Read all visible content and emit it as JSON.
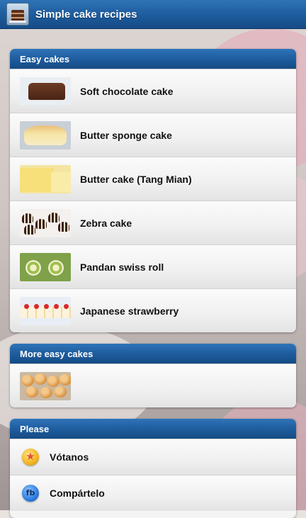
{
  "app": {
    "title": "Simple cake recipes",
    "icon": "cake-app-icon"
  },
  "sections": [
    {
      "header": "Easy cakes",
      "items": [
        {
          "label": "Soft chocolate cake",
          "thumb": "chocolate-cake-thumb"
        },
        {
          "label": "Butter sponge cake",
          "thumb": "sponge-cake-thumb"
        },
        {
          "label": "Butter cake (Tang Mian)",
          "thumb": "butter-cake-thumb"
        },
        {
          "label": "Zebra cake",
          "thumb": "zebra-cake-thumb"
        },
        {
          "label": "Pandan swiss roll",
          "thumb": "pandan-roll-thumb"
        },
        {
          "label": "Japanese strawberry",
          "thumb": "strawberry-cake-thumb"
        }
      ]
    },
    {
      "header": "More easy cakes",
      "items": [
        {
          "label": "",
          "thumb": "buns-thumb"
        }
      ]
    },
    {
      "header": "Please",
      "items": [
        {
          "label": "Vótanos",
          "icon": "star-icon"
        },
        {
          "label": "Compártelo",
          "icon": "facebook-icon"
        }
      ]
    }
  ],
  "colors": {
    "header_blue": "#1d5b9c",
    "row_bg": "#f0f0f0",
    "text": "#111111"
  }
}
